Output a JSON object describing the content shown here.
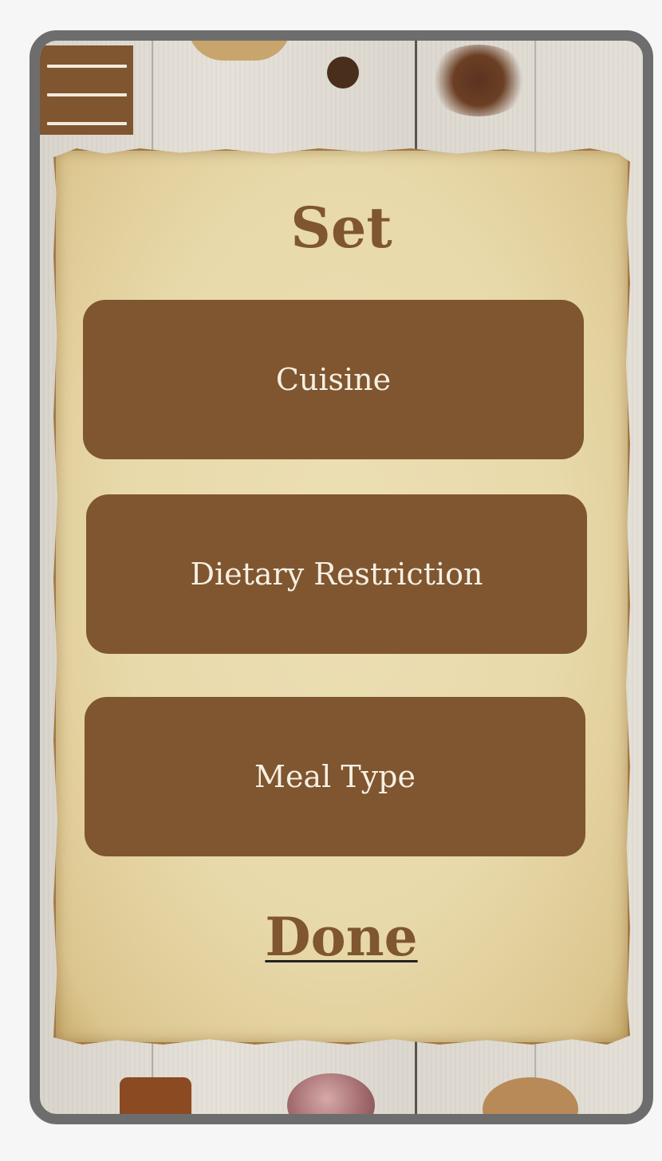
{
  "colors": {
    "accent": "#7f5630",
    "button_text": "#f7efe2",
    "frame": "#6d6d6d",
    "parchment": "#e8d9aa"
  },
  "menu": {
    "icon": "hamburger-menu-icon"
  },
  "screen": {
    "title": "Set",
    "options": [
      {
        "label": "Cuisine"
      },
      {
        "label": "Dietary Restriction"
      },
      {
        "label": "Meal Type"
      }
    ],
    "done_label": "Done"
  }
}
